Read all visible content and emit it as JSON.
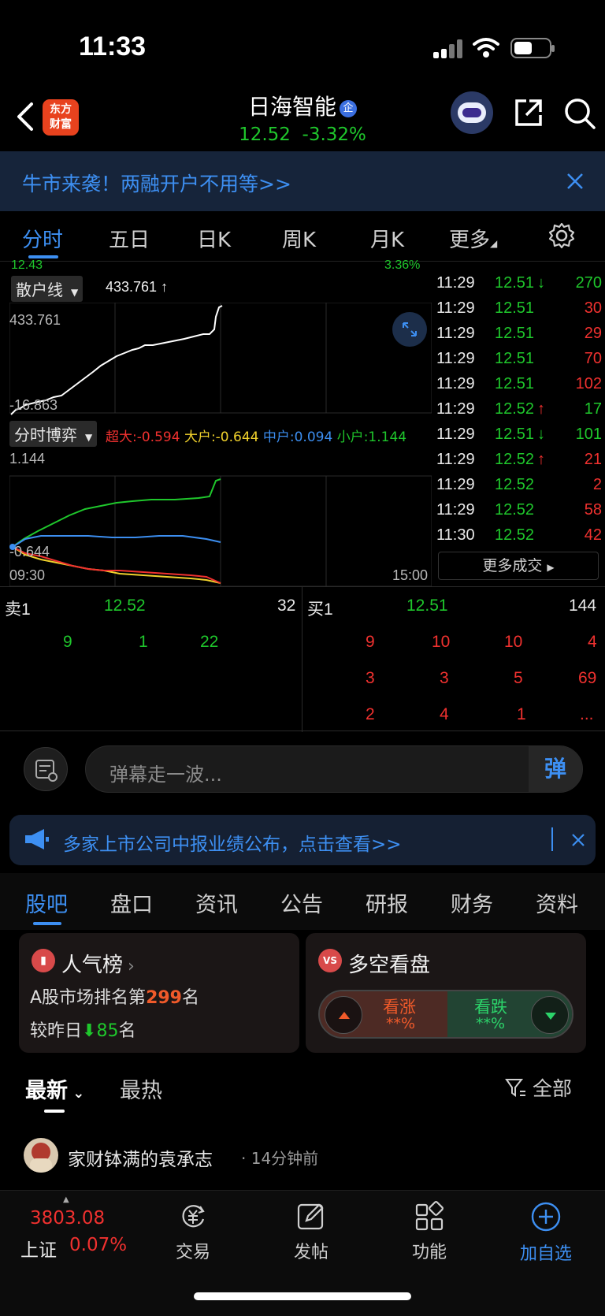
{
  "status_bar": {
    "time": "11:33"
  },
  "header": {
    "logo_line1": "东方",
    "logo_line2": "财富",
    "stock_name": "日海智能",
    "badge": "企",
    "price": "12.52",
    "change_pct": "-3.32%"
  },
  "banner": {
    "text": "牛市来袭！两融开户不用等>>"
  },
  "chart_tabs": [
    "分时",
    "五日",
    "日K",
    "周K",
    "月K",
    "更多"
  ],
  "chart": {
    "top_left_cut": "12.43",
    "top_right_cut": "3.36%",
    "retail_panel": {
      "label": "散户线",
      "value": "433.761 ↑",
      "max": "433.761",
      "min": "-16.863"
    },
    "game_panel": {
      "label": "分时博弈",
      "legend": [
        {
          "name": "超大",
          "value": ":-0.594",
          "color": "#f0312f"
        },
        {
          "name": "大户",
          "value": ":-0.644",
          "color": "#f0d12c"
        },
        {
          "name": "中户",
          "value": ":0.094",
          "color": "#3c8ef0"
        },
        {
          "name": "小户",
          "value": ":1.144",
          "color": "#1fc72c"
        }
      ],
      "max": "1.144",
      "min": "-0.644"
    },
    "time_start": "09:30",
    "time_end": "15:00"
  },
  "ticks": [
    {
      "time": "11:29",
      "price": "12.51",
      "arrow": "↓",
      "arrow_color": "#1fc72c",
      "price_color": "#1fc72c",
      "vol": "270",
      "vol_color": "#1fc72c"
    },
    {
      "time": "11:29",
      "price": "12.51",
      "arrow": "",
      "arrow_color": "",
      "price_color": "#1fc72c",
      "vol": "30",
      "vol_color": "#f0312f"
    },
    {
      "time": "11:29",
      "price": "12.51",
      "arrow": "",
      "arrow_color": "",
      "price_color": "#1fc72c",
      "vol": "29",
      "vol_color": "#f0312f"
    },
    {
      "time": "11:29",
      "price": "12.51",
      "arrow": "",
      "arrow_color": "",
      "price_color": "#1fc72c",
      "vol": "70",
      "vol_color": "#f0312f"
    },
    {
      "time": "11:29",
      "price": "12.51",
      "arrow": "",
      "arrow_color": "",
      "price_color": "#1fc72c",
      "vol": "102",
      "vol_color": "#f0312f"
    },
    {
      "time": "11:29",
      "price": "12.52",
      "arrow": "↑",
      "arrow_color": "#f0312f",
      "price_color": "#1fc72c",
      "vol": "17",
      "vol_color": "#1fc72c"
    },
    {
      "time": "11:29",
      "price": "12.51",
      "arrow": "↓",
      "arrow_color": "#1fc72c",
      "price_color": "#1fc72c",
      "vol": "101",
      "vol_color": "#1fc72c"
    },
    {
      "time": "11:29",
      "price": "12.52",
      "arrow": "↑",
      "arrow_color": "#f0312f",
      "price_color": "#1fc72c",
      "vol": "21",
      "vol_color": "#f0312f"
    },
    {
      "time": "11:29",
      "price": "12.52",
      "arrow": "",
      "arrow_color": "",
      "price_color": "#1fc72c",
      "vol": "2",
      "vol_color": "#f0312f"
    },
    {
      "time": "11:29",
      "price": "12.52",
      "arrow": "",
      "arrow_color": "",
      "price_color": "#1fc72c",
      "vol": "58",
      "vol_color": "#f0312f"
    },
    {
      "time": "11:30",
      "price": "12.52",
      "arrow": "",
      "arrow_color": "",
      "price_color": "#1fc72c",
      "vol": "42",
      "vol_color": "#f0312f"
    }
  ],
  "more_deals": "更多成交",
  "orderbook": {
    "sell_label": "卖1",
    "sell_price": "12.52",
    "sell_vol": "32",
    "buy_label": "买1",
    "buy_price": "12.51",
    "buy_vol": "144",
    "sell_queue": [
      "9",
      "1",
      "22"
    ],
    "buy_queue": [
      [
        "9",
        "10",
        "10",
        "4"
      ],
      [
        "3",
        "3",
        "5",
        "69"
      ],
      [
        "2",
        "4",
        "1",
        "..."
      ]
    ]
  },
  "danmu": {
    "placeholder": "弹幕走一波...",
    "button": "弹"
  },
  "notice": {
    "text": "多家上市公司中报业绩公布，点击查看>>"
  },
  "section_tabs": [
    "股吧",
    "盘口",
    "资讯",
    "公告",
    "研报",
    "财务",
    "资料"
  ],
  "popularity_card": {
    "title": "人气榜",
    "rank_prefix": "A股市场排名第",
    "rank": "299",
    "rank_suffix": "名",
    "change_prefix": "较昨日",
    "change": "85",
    "change_suffix": "名"
  },
  "sentiment_card": {
    "title": "多空看盘",
    "icon_text": "VS",
    "bull_label": "看涨",
    "bull_value": "**%",
    "bear_label": "看跌",
    "bear_value": "**%"
  },
  "feed": {
    "tab_latest": "最新",
    "tab_hot": "最热",
    "filter": "全部",
    "post_author": "家财钵满的袁承志",
    "post_time": "· 14分钟前"
  },
  "bottom_bar": {
    "index_value": "3803.08",
    "index_name": "上证",
    "index_change": "0.07%",
    "items": [
      "交易",
      "发帖",
      "功能",
      "加自选"
    ]
  }
}
